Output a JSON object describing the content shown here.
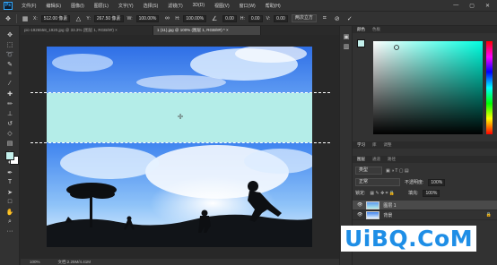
{
  "app": {
    "logo_text": "Ps"
  },
  "menu": [
    "文件(F)",
    "编辑(E)",
    "图像(I)",
    "图层(L)",
    "文字(Y)",
    "选择(S)",
    "滤镜(T)",
    "3D(D)",
    "视图(V)",
    "窗口(W)",
    "帮助(H)"
  ],
  "window_controls": {
    "minimize": "—",
    "maximize": "▢",
    "close": "✕"
  },
  "options": {
    "x_label": "X:",
    "x_value": "512.00 像素",
    "y_label": "Y:",
    "y_value": "267.50 像素",
    "w_label": "W:",
    "w_value": "100.00%",
    "h_label": "H:",
    "h_value": "100.00%",
    "angle_value": "0.00",
    "h2_label": "H:",
    "h2_value": "0.00",
    "v_label": "V:",
    "v_value": "0.00",
    "interp_value": "两次立方",
    "commit_icon": "checkmark-icon",
    "cancel_icon": "cancel-icon"
  },
  "tabs": [
    {
      "label": "pic-1926558_1920.jpg @ 33.3% (图层 1, RGB/8#) ×",
      "active": false
    },
    {
      "label": "1 (11).jpg @ 100% (图层 1, RGB/8#) * ×",
      "active": true
    }
  ],
  "status": {
    "zoom": "100%",
    "doc": "文档:2.25M/4.41M"
  },
  "color_panel": {
    "tabs": [
      "颜色",
      "色板"
    ],
    "fg_hex": "#c4f0ec"
  },
  "mid_panel": {
    "tabs": [
      "学习",
      "库",
      "调整"
    ]
  },
  "layers_panel": {
    "tabs": [
      "图层",
      "通道",
      "路径"
    ],
    "kind_label": "类型",
    "blend_mode": "正常",
    "opacity_label": "不透明度:",
    "opacity_value": "100%",
    "lock_label": "锁定:",
    "fill_label": "填充:",
    "fill_value": "100%",
    "layers": [
      {
        "name": "图层 1",
        "selected": true
      },
      {
        "name": "背景",
        "selected": false
      }
    ]
  },
  "watermark": "UiBQ.CoM"
}
